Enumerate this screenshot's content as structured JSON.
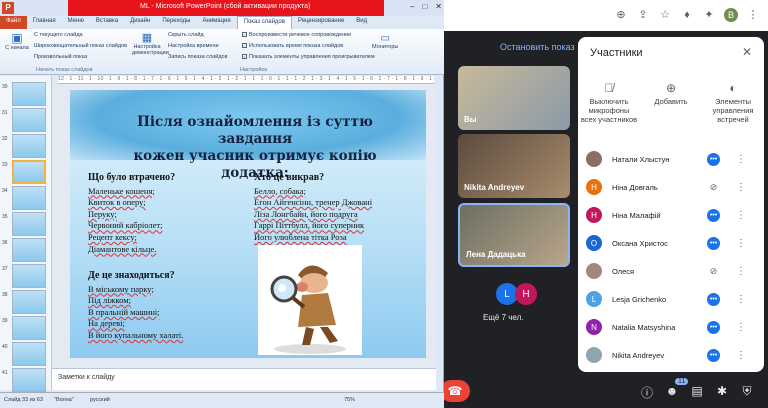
{
  "browser": {
    "icons": [
      "zoom-icon",
      "share-icon",
      "star-icon",
      "shield-icon",
      "extension-icon",
      "profile-icon",
      "menu-icon"
    ],
    "profile_letter": "B"
  },
  "ppt": {
    "window_title": "ML - Microsoft PowerPoint (сбой активации продукта)",
    "tabs": [
      "Файл",
      "Главная",
      "Меню",
      "Вставка",
      "Дизайн",
      "Переходы",
      "Анимация",
      "Показ слайдов",
      "Рецензирование",
      "Вид"
    ],
    "active_tab": "Показ слайдов",
    "ribbon": {
      "start_label": "С начала",
      "from_current": "С текущего слайда",
      "broadcast": "Широковещательный показ слайдов",
      "custom_show": "Произвольный показ",
      "group1": "Начать показ слайдов",
      "setup": "Настройка демонстрации",
      "hide_slide": "Скрыть слайд",
      "rehearse": "Настройка времени",
      "record": "Запись показа слайдов",
      "play_narrations": "Воспроизвести речевое сопровождение",
      "use_timings": "Использовать время показа слайдов",
      "show_media": "Показать элементы управления проигрывателем",
      "group2": "Настройка",
      "monitors": "Мониторы"
    },
    "ruler": "12 · 1 · 11 · 1 · 10 · 1 · 9 · 1 · 8 · 1 · 7 · 1 · 6 · 1 · 5 · 1 · 4 · 1 · 3 · 1 · 2 · 1 · 1 · 1 · 0 · 1 · 1 · 1 · 2 · 1 · 3 · 1 · 4 · 1 · 5 · 1 · 6 · 1 · 7 · 1 · 8 · 1 · 9 · 1 · 10 · 1 · 11 · 1 · 12",
    "thumb_numbers": [
      "30",
      "31",
      "32",
      "33",
      "34",
      "35",
      "36",
      "37",
      "38",
      "39",
      "40",
      "41"
    ],
    "selected_thumb": "33",
    "slide": {
      "title_line1": "Після ознайомлення із суттю завдання",
      "title_line2": "кожен учасник отримує копію додатка:",
      "left_head": "Що було втрачено?",
      "left_items": [
        "Маленьке кошеня;",
        "Квиток в оперу;",
        "Перуку;",
        "Червоний кабріолет;",
        "Рецепт кексу;",
        "Діамантове кільце."
      ],
      "left_head2": "Де це знаходиться?",
      "left_items2": [
        "В міському парку;",
        "Під ліжком;",
        "В пральній машині;",
        "На дереві;",
        "В його купальному халаті."
      ],
      "right_head": "Хто це викрав?",
      "right_items": [
        "Белло, собака;",
        "Егон Айгенсінн,  тренер Джовані",
        "Ліза Лонгбайн, його подруга",
        "Гаррі Піттбулл, його суперник",
        "Його улюблена тітка Роза"
      ]
    },
    "notes_placeholder": "Заметки к слайду",
    "status": {
      "slide_info": "Слайд 33 из 63",
      "theme": "\"Волна\"",
      "language": "русский",
      "zoom": "75%"
    }
  },
  "meet": {
    "stop_sharing": "Остановить показ",
    "tiles": [
      {
        "name": "Вы"
      },
      {
        "name": "Nikita Andreyev"
      },
      {
        "name": "Лена Дадацька"
      }
    ],
    "more_count": "Ещё 7 чел.",
    "more_avatars": [
      {
        "letter": "L",
        "color": "#1a73e8"
      },
      {
        "letter": "Н",
        "color": "#c2185b"
      }
    ],
    "participants_badge": "11"
  },
  "panel": {
    "title": "Участники",
    "actions": [
      {
        "icon": "mic-off-icon",
        "label": "Выключить микрофоны всех участников"
      },
      {
        "icon": "add-person-icon",
        "label": "Добавить"
      },
      {
        "icon": "toggle-icon",
        "label": "Элементы управления встречей"
      }
    ],
    "participants": [
      {
        "name": "Натали Хлыстун",
        "letter": "",
        "color": "#8d6e63",
        "mic": "on"
      },
      {
        "name": "Ніна Довгаль",
        "letter": "Н",
        "color": "#e8710a",
        "mic": "off"
      },
      {
        "name": "Ніна Малафій",
        "letter": "Н",
        "color": "#c2185b",
        "mic": "on"
      },
      {
        "name": "Оксана Христос",
        "letter": "О",
        "color": "#1967d2",
        "mic": "on"
      },
      {
        "name": "Олеся",
        "letter": "",
        "color": "#a1887f",
        "mic": "off"
      },
      {
        "name": "Lesja Grichenko",
        "letter": "L",
        "color": "#4fa3e0",
        "mic": "on"
      },
      {
        "name": "Natalia Matsyshina",
        "letter": "N",
        "color": "#8e24aa",
        "mic": "on"
      },
      {
        "name": "Nikita Andreyev",
        "letter": "",
        "color": "#90a4ae",
        "mic": "on"
      }
    ]
  }
}
